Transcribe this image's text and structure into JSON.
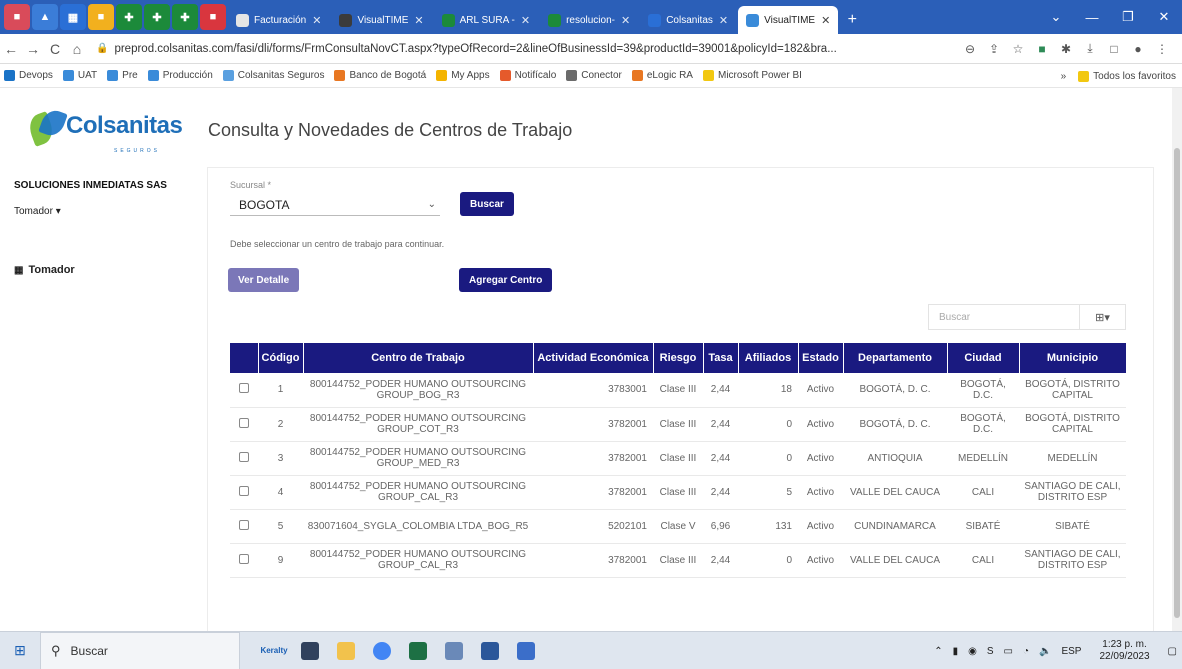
{
  "browser": {
    "tabs": [
      {
        "label": "Facturación",
        "color": "#e5e5e5"
      },
      {
        "label": "VisualTIME",
        "color": "#3b3b3b"
      },
      {
        "label": "ARL SURA -",
        "color": "#1c8a3a"
      },
      {
        "label": "resolucion-",
        "color": "#1c8a3a"
      },
      {
        "label": "Colsanitas",
        "color": "#2a6fd6"
      },
      {
        "label": "VisualTIME",
        "color": "#3a8bd9"
      }
    ],
    "url": "preprod.colsanitas.com/fasi/dli/forms/FrmConsultaNovCT.aspx?typeOfRecord=2&lineOfBusinessId=39&productId=39001&policyId=182&bra...",
    "bookmarks": [
      {
        "label": "Devops",
        "color": "#1a73c7"
      },
      {
        "label": "UAT",
        "color": "#3a8bd9"
      },
      {
        "label": "Pre",
        "color": "#3a8bd9"
      },
      {
        "label": "Producción",
        "color": "#3a8bd9"
      },
      {
        "label": "Colsanitas Seguros",
        "color": "#5aa0e0"
      },
      {
        "label": "Banco de Bogotá",
        "color": "#e87722"
      },
      {
        "label": "My Apps",
        "color": "#f4b400"
      },
      {
        "label": "Notifícalo",
        "color": "#e55a2b"
      },
      {
        "label": "Conector",
        "color": "#6b6b6b"
      },
      {
        "label": "eLogic RA",
        "color": "#e87722"
      },
      {
        "label": "Microsoft Power BI",
        "color": "#f2c811"
      }
    ],
    "bookmarks_more": "»",
    "all_favorites": "Todos los favoritos"
  },
  "sidebar": {
    "logo_text": "Colsanitas",
    "logo_sub": "SEGUROS",
    "company": "SOLUCIONES INMEDIATAS SAS",
    "role_dropdown": "Tomador",
    "menu_item": "Tomador"
  },
  "main": {
    "title": "Consulta y Novedades de Centros de Trabajo",
    "sucursal_label": "Sucursal *",
    "sucursal_value": "BOGOTA",
    "buscar_button": "Buscar",
    "hint": "Debe seleccionar un centro de trabajo para continuar.",
    "ver_detalle": "Ver Detalle",
    "agregar_centro": "Agregar Centro",
    "search_placeholder": "Buscar",
    "columns": [
      "",
      "Código",
      "Centro de Trabajo",
      "Actividad Económica",
      "Riesgo",
      "Tasa",
      "Afiliados",
      "Estado",
      "Departamento",
      "Ciudad",
      "Municipio"
    ],
    "rows": [
      {
        "codigo": "1",
        "centro": "800144752_PODER HUMANO OUTSOURCING GROUP_BOG_R3",
        "actividad": "3783001",
        "riesgo": "Clase III",
        "tasa": "2,44",
        "afiliados": "18",
        "estado": "Activo",
        "departamento": "BOGOTÁ, D. C.",
        "ciudad": "BOGOTÁ, D.C.",
        "municipio": "BOGOTÁ, DISTRITO CAPITAL"
      },
      {
        "codigo": "2",
        "centro": "800144752_PODER HUMANO OUTSOURCING GROUP_COT_R3",
        "actividad": "3782001",
        "riesgo": "Clase III",
        "tasa": "2,44",
        "afiliados": "0",
        "estado": "Activo",
        "departamento": "BOGOTÁ, D. C.",
        "ciudad": "BOGOTÁ, D.C.",
        "municipio": "BOGOTÁ, DISTRITO CAPITAL"
      },
      {
        "codigo": "3",
        "centro": "800144752_PODER HUMANO OUTSOURCING GROUP_MED_R3",
        "actividad": "3782001",
        "riesgo": "Clase III",
        "tasa": "2,44",
        "afiliados": "0",
        "estado": "Activo",
        "departamento": "ANTIOQUIA",
        "ciudad": "MEDELLÍN",
        "municipio": "MEDELLÍN"
      },
      {
        "codigo": "4",
        "centro": "800144752_PODER HUMANO OUTSOURCING GROUP_CAL_R3",
        "actividad": "3782001",
        "riesgo": "Clase III",
        "tasa": "2,44",
        "afiliados": "5",
        "estado": "Activo",
        "departamento": "VALLE DEL CAUCA",
        "ciudad": "CALI",
        "municipio": "SANTIAGO DE CALI, DISTRITO ESP"
      },
      {
        "codigo": "5",
        "centro": "830071604_SYGLA_COLOMBIA LTDA_BOG_R5",
        "actividad": "5202101",
        "riesgo": "Clase V",
        "tasa": "6,96",
        "afiliados": "131",
        "estado": "Activo",
        "departamento": "CUNDINAMARCA",
        "ciudad": "SIBATÉ",
        "municipio": "SIBATÉ"
      },
      {
        "codigo": "9",
        "centro": "800144752_PODER HUMANO OUTSOURCING GROUP_CAL_R3",
        "actividad": "3782001",
        "riesgo": "Clase III",
        "tasa": "2,44",
        "afiliados": "0",
        "estado": "Activo",
        "departamento": "VALLE DEL CAUCA",
        "ciudad": "CALI",
        "municipio": "SANTIAGO DE CALI, DISTRITO ESP"
      }
    ]
  },
  "taskbar": {
    "search": "Buscar",
    "keralty": "Keralty",
    "lang": "ESP",
    "time": "1:23 p. m.",
    "date": "22/09/2023"
  }
}
